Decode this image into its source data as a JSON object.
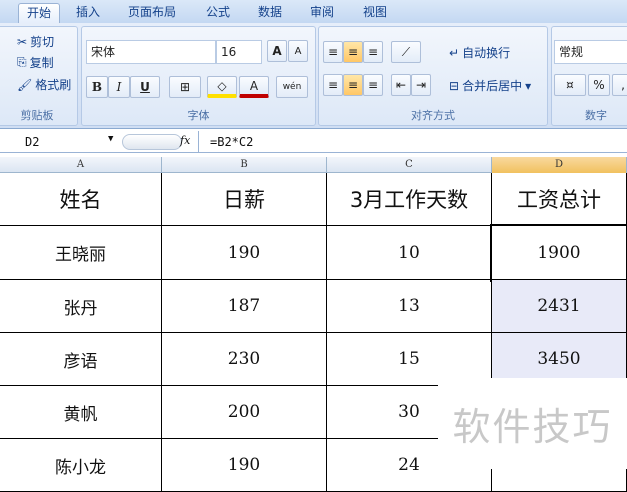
{
  "tabs": [
    "开始",
    "插入",
    "页面布局",
    "公式",
    "数据",
    "审阅",
    "视图"
  ],
  "clipboard": {
    "cut": "剪切",
    "copy": "复制",
    "format_painter": "格式刷",
    "label": "剪贴板"
  },
  "font": {
    "name": "宋体",
    "size": "16",
    "bold": "B",
    "italic": "I",
    "underline": "U",
    "label": "字体",
    "grow": "A",
    "shrink": "A",
    "phonetic": "wén"
  },
  "align": {
    "wrap": "自动换行",
    "merge": "合并后居中",
    "label": "对齐方式"
  },
  "number": {
    "format": "常规",
    "percent": "%",
    "comma": ",",
    "label": "数字"
  },
  "formula_bar": {
    "name_box": "D2",
    "fx": "fx",
    "formula": "=B2*C2"
  },
  "columns": [
    "A",
    "B",
    "C",
    "D"
  ],
  "rows": [
    [
      "姓名",
      "日薪",
      "3月工作天数",
      "工资总计"
    ],
    [
      "王晓丽",
      "190",
      "10",
      "1900"
    ],
    [
      "张丹",
      "187",
      "13",
      "2431"
    ],
    [
      "彦语",
      "230",
      "15",
      "3450"
    ],
    [
      "黄帆",
      "200",
      "30",
      ""
    ],
    [
      "陈小龙",
      "190",
      "24",
      ""
    ]
  ],
  "watermark": "软件技巧"
}
